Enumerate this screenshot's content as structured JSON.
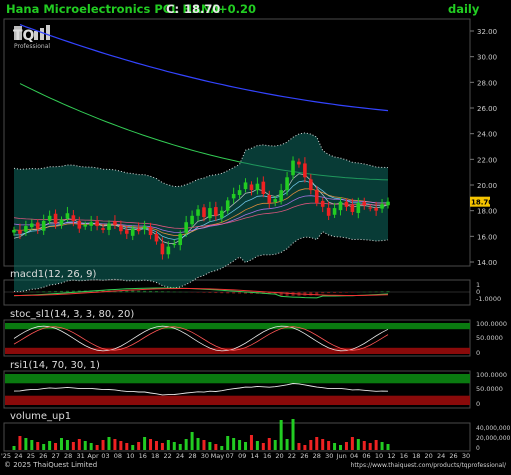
{
  "header": {
    "title": "Hana Microelectronics PCL HANA",
    "close_label": "C:",
    "close_value": "18.70",
    "change": "+0.20",
    "period": "daily"
  },
  "logo": {
    "mark": "TQ",
    "sub": "Professional"
  },
  "colors": {
    "background": "#000000",
    "header_text": "#22cc22",
    "up_candle": "#22cc22",
    "down_candle": "#ee2222",
    "ma_long": "#3344ff",
    "ma_mid": "#33cc55",
    "bollinger_fill": "#0f6b62",
    "macd_line": "#33cc55",
    "macd_signal": "#ee3333",
    "overbought": "#0a7a10",
    "oversold": "#8a0a0a",
    "volume": "#22cc22",
    "price_tag": "#f5c400"
  },
  "price_axis": {
    "ticks": [
      "32.00",
      "30.00",
      "28.00",
      "26.00",
      "24.00",
      "22.00",
      "20.00",
      "18.00",
      "16.00",
      "14.00"
    ],
    "last_tag": "18.70"
  },
  "panels": {
    "macd": {
      "title": "macd1(12, 26, 9)",
      "ticks": [
        "1",
        "0",
        "-1.0000"
      ]
    },
    "stoch": {
      "title": "stoc_sl1(14, 3, 3, 80, 20)",
      "ticks": [
        "100.0000",
        "50.0000",
        "0"
      ]
    },
    "rsi": {
      "title": "rsi1(14, 70, 30, 1)",
      "ticks": [
        "100.0000",
        "50.0000",
        "0"
      ]
    },
    "volume": {
      "title": "volume_up1",
      "ticks": [
        "40,000,000",
        "20,000,000",
        "0"
      ]
    }
  },
  "x_axis": {
    "labels": [
      "'25",
      "24",
      "25",
      "26",
      "27",
      "28",
      "31",
      "Apr",
      "03",
      "08",
      "10",
      "16",
      "18",
      "22",
      "24",
      "28",
      "30",
      "May",
      "07",
      "09",
      "14",
      "16",
      "20",
      "22",
      "26",
      "28",
      "30",
      "Jun",
      "04",
      "06",
      "10",
      "12",
      "16",
      "18",
      "20",
      "24",
      "26",
      "30"
    ]
  },
  "footer": {
    "copyright": "© 2025 ThaiQuest Limited",
    "url": "https://www.thaiquest.com/products/tqprofessional/"
  },
  "chart_data": {
    "type": "candlestick",
    "title": "Hana Microelectronics PCL HANA",
    "ylim": [
      13.5,
      33
    ],
    "closes": [
      16.5,
      16.2,
      16.8,
      17.0,
      16.6,
      17.2,
      17.6,
      17.0,
      17.3,
      17.8,
      17.2,
      16.6,
      16.9,
      17.1,
      16.8,
      16.5,
      17.0,
      16.9,
      16.4,
      16.2,
      16.6,
      16.4,
      16.8,
      16.1,
      15.6,
      14.6,
      15.2,
      15.4,
      16.2,
      17.1,
      17.6,
      18.1,
      17.5,
      18.2,
      17.6,
      18.0,
      18.8,
      19.3,
      19.6,
      20.2,
      19.6,
      20.1,
      19.3,
      18.6,
      18.9,
      19.6,
      20.6,
      21.9,
      21.6,
      20.6,
      19.6,
      18.6,
      18.3,
      17.6,
      18.2,
      18.7,
      18.3,
      17.9,
      18.6,
      18.4,
      18.2,
      18.0,
      18.5,
      18.7
    ],
    "ma_long_endpoints": [
      32.5,
      25.8
    ],
    "ma_mid_endpoints": [
      27.9,
      20.4
    ],
    "bollinger_upper_endpoints": [
      24.2,
      21.1
    ],
    "macd_axis_ticks": [
      1,
      0,
      -1
    ],
    "stochastic_levels": [
      20,
      80
    ],
    "rsi_levels": [
      30,
      70
    ],
    "volume_axis_ticks": [
      0,
      20000000,
      40000000
    ],
    "last_close": 18.7,
    "change": 0.2
  }
}
